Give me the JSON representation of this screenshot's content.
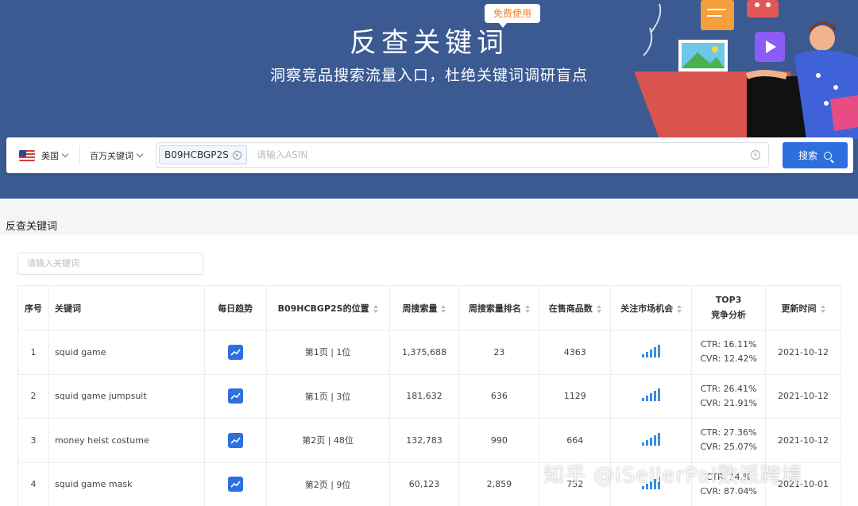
{
  "hero": {
    "title": "反查关键词",
    "subtitle": "洞察竞品搜索流量入口，杜绝关键词调研盲点",
    "badge": "免费使用"
  },
  "searchbar": {
    "country": "美国",
    "library": "百万关键词",
    "tag": "B09HCBGP2S",
    "placeholder": "请输入ASIN",
    "button": "搜索"
  },
  "section": {
    "title": "反查关键词",
    "filter_placeholder": "请输入关键词"
  },
  "table": {
    "headers": {
      "index": "序号",
      "keyword": "关键词",
      "trend": "每日趋势",
      "position": "B09HCBGP2S的位置",
      "weekly_search": "周搜索量",
      "weekly_rank": "周搜索量排名",
      "products": "在售商品数",
      "opportunity": "关注市场机会",
      "top3_line1": "TOP3",
      "top3_line2": "竞争分析",
      "updated": "更新时间"
    },
    "rows": [
      {
        "index": "1",
        "keyword": "squid game",
        "position": "第1页 | 1位",
        "weekly_search": "1,375,688",
        "weekly_rank": "23",
        "products": "4363",
        "ctr": "CTR: 16.11%",
        "cvr": "CVR: 12.42%",
        "updated": "2021-10-12"
      },
      {
        "index": "2",
        "keyword": "squid game jumpsuit",
        "position": "第1页 | 3位",
        "weekly_search": "181,632",
        "weekly_rank": "636",
        "products": "1129",
        "ctr": "CTR: 26.41%",
        "cvr": "CVR: 21.91%",
        "updated": "2021-10-12"
      },
      {
        "index": "3",
        "keyword": "money heist costume",
        "position": "第2页 | 48位",
        "weekly_search": "132,783",
        "weekly_rank": "990",
        "products": "664",
        "ctr": "CTR: 27.36%",
        "cvr": "CVR: 25.07%",
        "updated": "2021-10-12"
      },
      {
        "index": "4",
        "keyword": "squid game mask",
        "position": "第2页 | 9位",
        "weekly_search": "60,123",
        "weekly_rank": "2,859",
        "products": "752",
        "ctr": "CTR: 14.%",
        "cvr": "CVR: 87.04%",
        "updated": "2021-10-01"
      }
    ]
  },
  "watermark": "知乎 @iSellerPal数派跨境",
  "colors": {
    "hero_bg": "#3b5a92",
    "accent": "#2e6fe0",
    "badge_text": "#f07d2b"
  }
}
